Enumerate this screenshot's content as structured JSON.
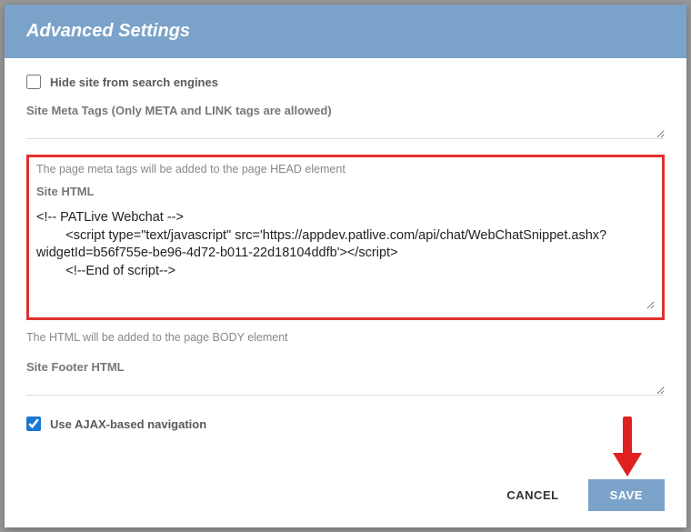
{
  "header": {
    "title": "Advanced Settings"
  },
  "hideFromSearch": {
    "label": "Hide site from search engines",
    "checked": false
  },
  "metaTags": {
    "label": "Site Meta Tags (Only META and LINK tags are allowed)",
    "value": "",
    "helpText": "The page meta tags will be added to the page HEAD element"
  },
  "siteHtml": {
    "label": "Site HTML",
    "value": "<!-- PATLive Webchat -->\n        <script type=\"text/javascript\" src='https://appdev.patlive.com/api/chat/WebChatSnippet.ashx?widgetId=b56f755e-be96-4d72-b011-22d18104ddfb'></script>\n        <!--End of script-->",
    "helpText": "The HTML will be added to the page BODY element"
  },
  "siteFooter": {
    "label": "Site Footer HTML",
    "value": ""
  },
  "ajaxNav": {
    "label": "Use AJAX-based navigation",
    "checked": true
  },
  "footer": {
    "cancelLabel": "CANCEL",
    "saveLabel": "SAVE"
  }
}
